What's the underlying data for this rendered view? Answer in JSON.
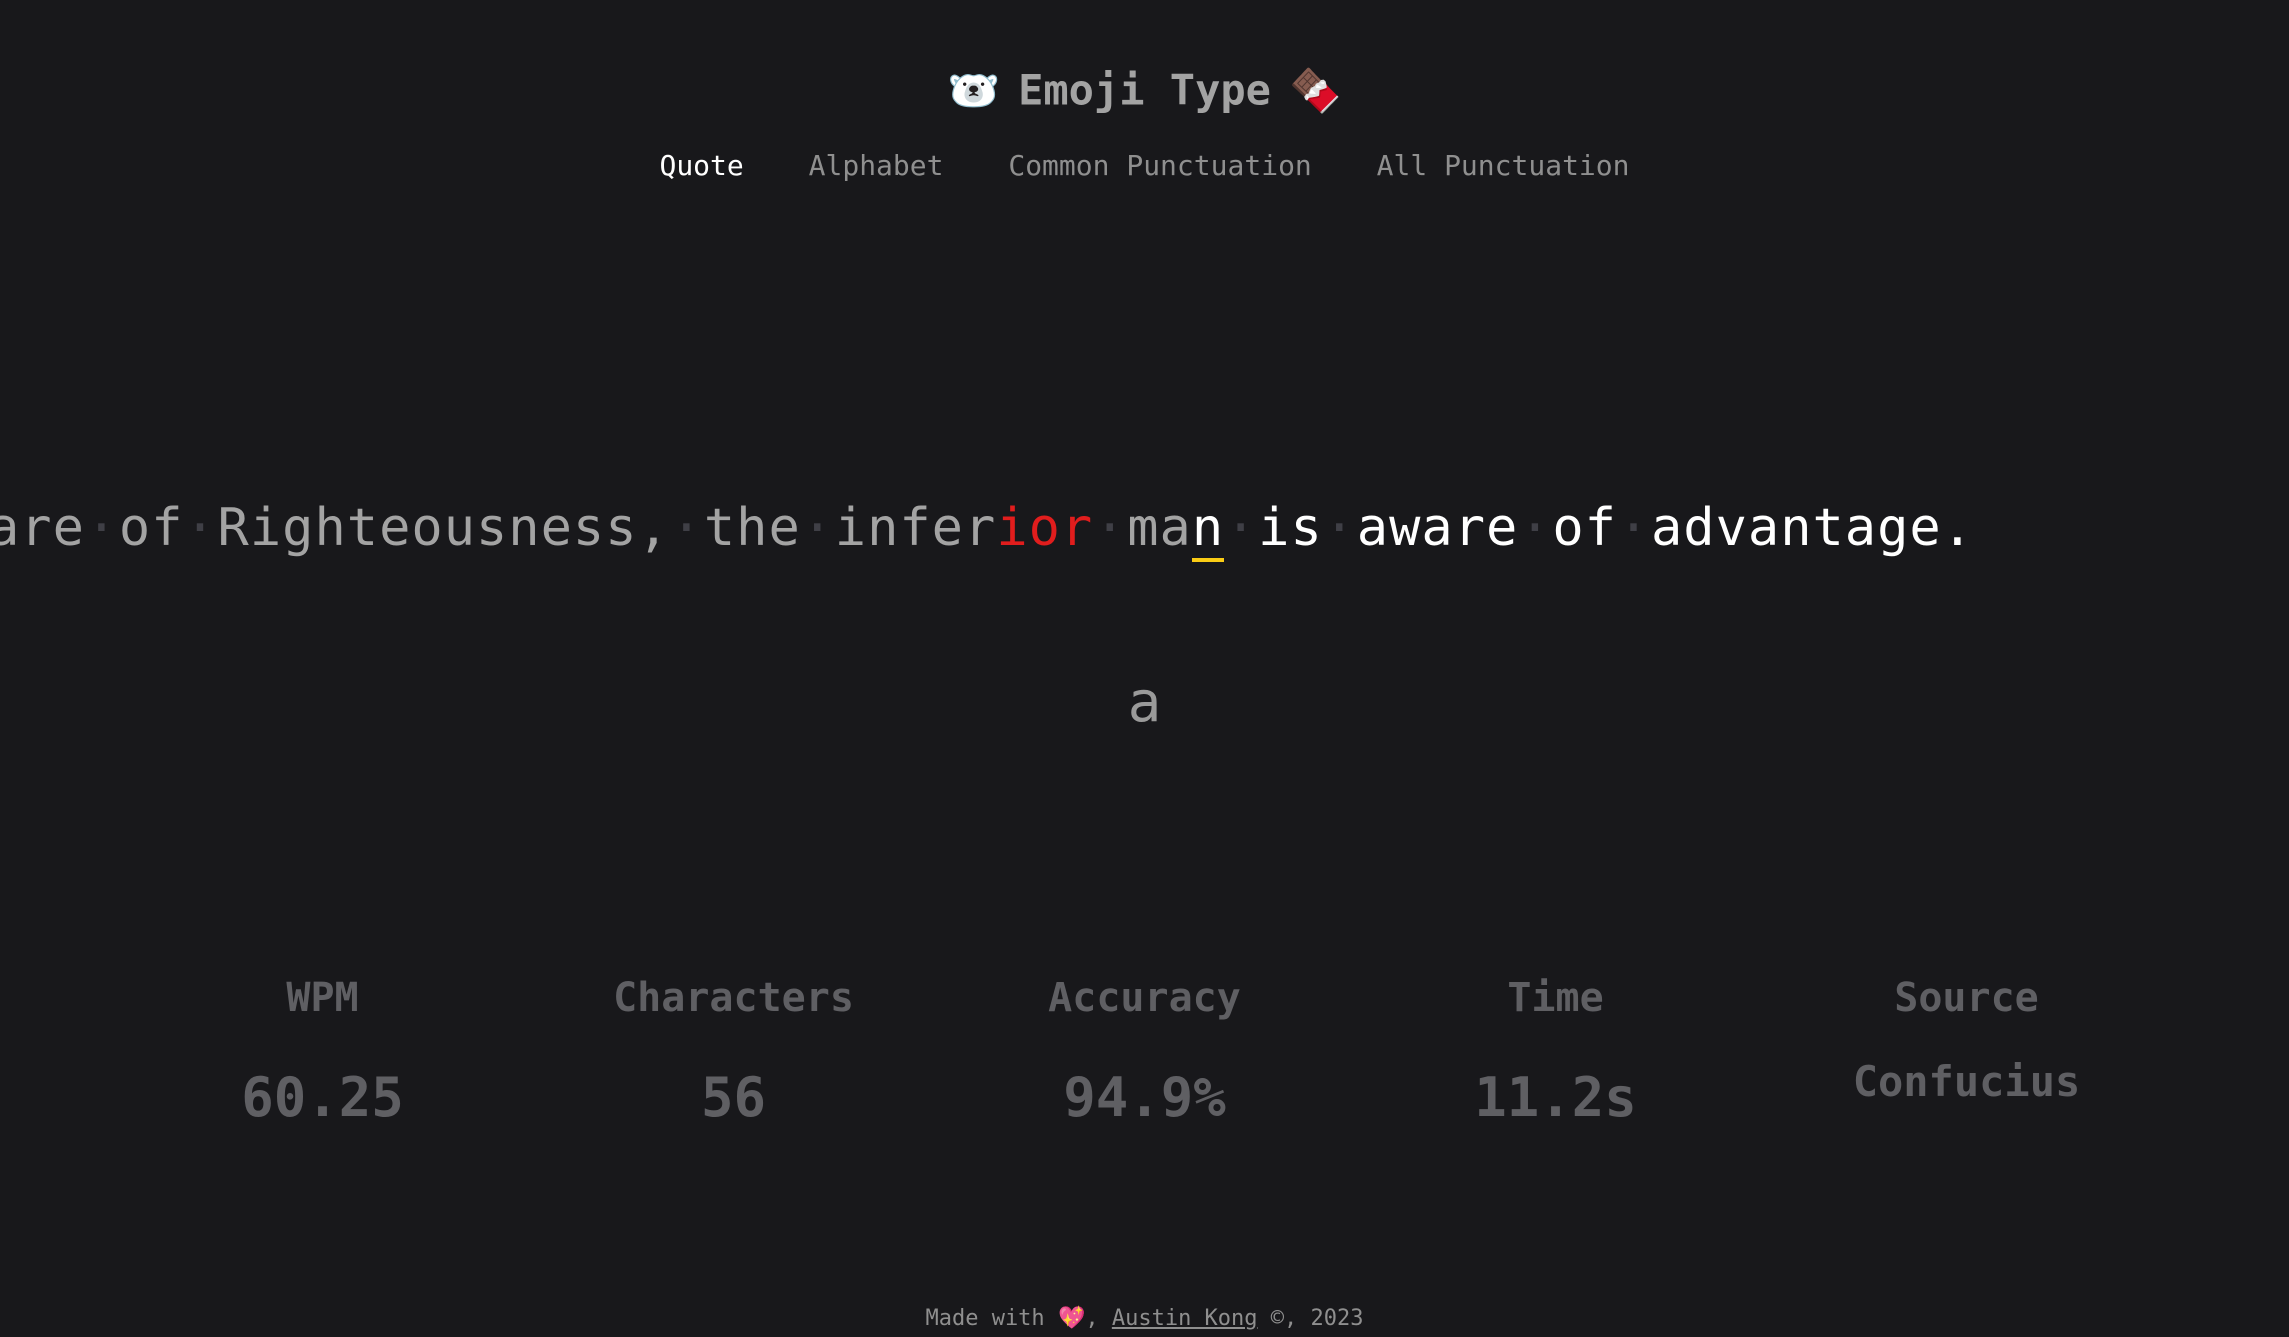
{
  "header": {
    "title": "Emoji Type",
    "left_emoji": "🐻‍❄️",
    "right_emoji": "🍫",
    "left_emoji_name": "polar-bear-icon",
    "right_emoji_name": "chocolate-bar-icon"
  },
  "nav": {
    "items": [
      "Quote",
      "Alphabet",
      "Common Punctuation",
      "All Punctuation"
    ],
    "active": "Quote"
  },
  "quote": {
    "words_typed": [
      "are",
      "of",
      "Righteousness,",
      "the"
    ],
    "current_word_correct": "infer",
    "current_word_wrong": "ior",
    "word_ma_typed": "ma",
    "cursor_char": "n",
    "remaining": [
      "is",
      "aware",
      "of",
      "advantage."
    ]
  },
  "next_key": "a",
  "stats": {
    "wpm_label": "WPM",
    "wpm_value": "60.25",
    "characters_label": "Characters",
    "characters_value": "56",
    "accuracy_label": "Accuracy",
    "accuracy_value": "94.9%",
    "time_label": "Time",
    "time_value": "11.2s",
    "source_label": "Source",
    "source_value": "Confucius"
  },
  "footer": {
    "prefix": "Made with",
    "emoji": "💖",
    "separator": ",",
    "author": "Austin Kong",
    "suffix": "©, 2023"
  },
  "colors": {
    "background": "#18181b",
    "cursor_underline": "#facc15",
    "error": "#e11d1d"
  }
}
